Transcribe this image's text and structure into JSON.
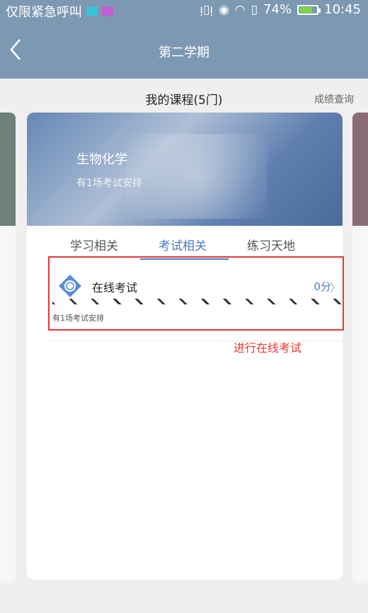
{
  "status_bar": {
    "carrier": "仅限紧急呼叫",
    "battery_percent": "74%",
    "time": "10:45"
  },
  "nav": {
    "title": "第二学期"
  },
  "courses": {
    "header": "我的课程(5门)",
    "grades_link": "成绩查询"
  },
  "course_card": {
    "name": "生物化学",
    "subtitle": "有1场考试安排",
    "tabs": [
      "学习相关",
      "考试相关",
      "练习天地"
    ],
    "active_tab": "考试相关",
    "exam_item": {
      "label": "在线考试",
      "score": "0分",
      "count_text": "有1场考试安排"
    }
  },
  "annotation": {
    "text": "进行在线考试",
    "color": "#e53935"
  },
  "colors": {
    "header_bg": "#7d98b3",
    "accent": "#4a7cc0"
  }
}
